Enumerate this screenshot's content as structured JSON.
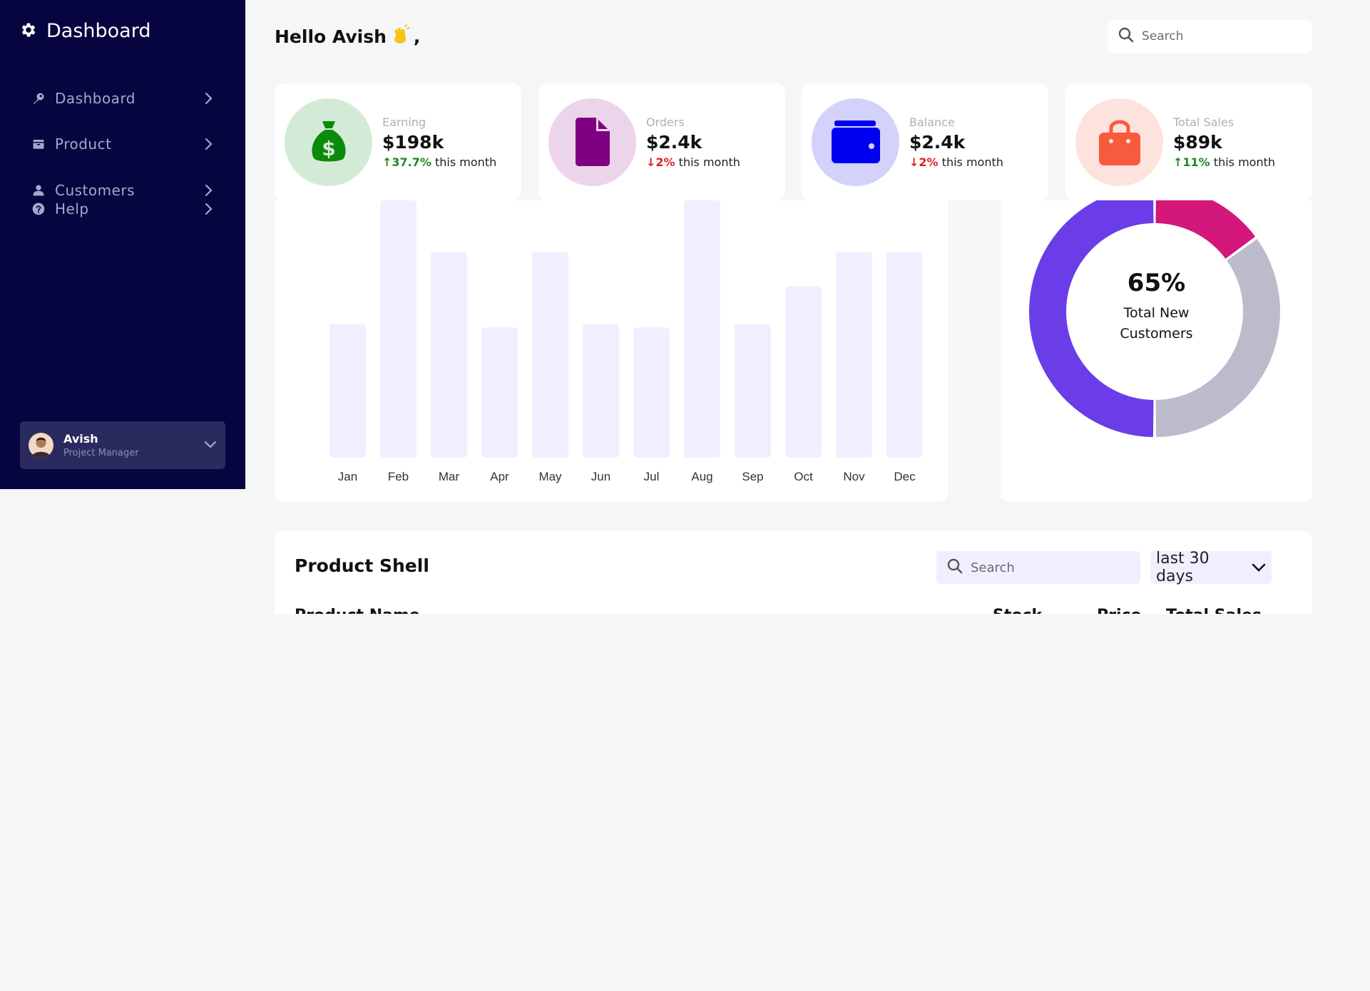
{
  "sidebar": {
    "brand": "Dashboard",
    "items": [
      {
        "label": "Dashboard",
        "icon": "key-icon"
      },
      {
        "label": "Product",
        "icon": "box-icon"
      },
      {
        "label": "Customers",
        "icon": "user-icon"
      },
      {
        "label": "Help",
        "icon": "question-icon"
      }
    ],
    "user": {
      "name": "Avish",
      "role": "Project Manager"
    }
  },
  "header": {
    "greeting": "Hello Avish",
    "greeting_suffix": ",",
    "search_placeholder": "Search"
  },
  "stats": [
    {
      "label": "Earning",
      "value": "$198k",
      "change": "↑37.7%",
      "direction": "up",
      "period": "this month",
      "icon": "money-bag-icon",
      "bg": "#d3ebd6",
      "fg": "#0b8a0b"
    },
    {
      "label": "Orders",
      "value": "$2.4k",
      "change": "↓2%",
      "direction": "down",
      "period": "this month",
      "icon": "document-icon",
      "bg": "#ecd5ea",
      "fg": "#7f0080"
    },
    {
      "label": "Balance",
      "value": "$2.4k",
      "change": "↓2%",
      "direction": "down",
      "period": "this month",
      "icon": "wallet-icon",
      "bg": "#d2d2fb",
      "fg": "#0000f0"
    },
    {
      "label": "Total Sales",
      "value": "$89k",
      "change": "↑11%",
      "direction": "up",
      "period": "this month",
      "icon": "shopping-bag-icon",
      "bg": "#fde2de",
      "fg": "#f75a3d"
    }
  ],
  "chart_data": [
    {
      "type": "bar",
      "categories": [
        "Jan",
        "Feb",
        "Mar",
        "Apr",
        "May",
        "Jun",
        "Jul",
        "Aug",
        "Sep",
        "Oct",
        "Nov",
        "Dec"
      ],
      "values": [
        39,
        75,
        60,
        38,
        60,
        39,
        38,
        75,
        39,
        50,
        60,
        60
      ],
      "ylim": [
        0,
        75
      ],
      "bar_color": "#f1efff"
    },
    {
      "type": "pie",
      "labels": [],
      "values": [
        50,
        15,
        35
      ],
      "colors": [
        "#6a3de8",
        "#d4177a",
        "#bcbbcb"
      ],
      "center_value": "65%",
      "center_label_line1": "Total New",
      "center_label_line2": "Customers"
    }
  ],
  "products": {
    "title": "Product Shell",
    "search_placeholder": "Search",
    "range": "last 30 days",
    "columns": [
      "Product Name",
      "Stock",
      "Price",
      "Total Sales"
    ]
  }
}
